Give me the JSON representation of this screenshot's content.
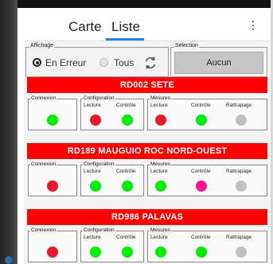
{
  "tabs": {
    "carte_label": "Carte",
    "liste_label": "Liste",
    "active_tab": "Liste",
    "accent_color": "#1e88e5"
  },
  "menu_icon": "more-vert-icon",
  "affichage": {
    "legend": "Affichage",
    "options": {
      "en_erreur": "En Erreur",
      "tous": "Tous"
    },
    "selected": "En Erreur",
    "refresh_icon": "refresh-icon"
  },
  "selection": {
    "legend": "Sélection",
    "button_label": "Aucun"
  },
  "labels": {
    "connexion": "Connexion",
    "configuration": "Configuration",
    "mesures": "Mesures",
    "lecture": "Lecture",
    "controle": "Contrôle",
    "rattrapage": "Rattrapage"
  },
  "colors": {
    "header_red": "#ff0000",
    "status_ok": "#00ee00",
    "status_error": "#e8192c",
    "status_warning": "#ff1493",
    "status_none": "#c0c0c0"
  },
  "stations": [
    {
      "name": "RD002 SETE",
      "connexion": "#00ee00",
      "config_lecture": "#e8192c",
      "config_controle": "#00ee00",
      "mesures_lecture": "#e8192c",
      "mesures_controle": "#00ee00",
      "mesures_rattrapage": "#c0c0c0"
    },
    {
      "name": "RD189 MAUGUIO ROC NORD-OUEST",
      "connexion": "#e8192c",
      "config_lecture": "#00ee00",
      "config_controle": "#00ee00",
      "mesures_lecture": "#00ee00",
      "mesures_controle": "#ff1493",
      "mesures_rattrapage": "#c0c0c0"
    },
    {
      "name": "RD986 PALAVAS",
      "connexion": "#e8192c",
      "config_lecture": "#00ee00",
      "config_controle": "#00ee00",
      "mesures_lecture": "#00ee00",
      "mesures_controle": "#00ee00",
      "mesures_rattrapage": "#c0c0c0"
    }
  ]
}
